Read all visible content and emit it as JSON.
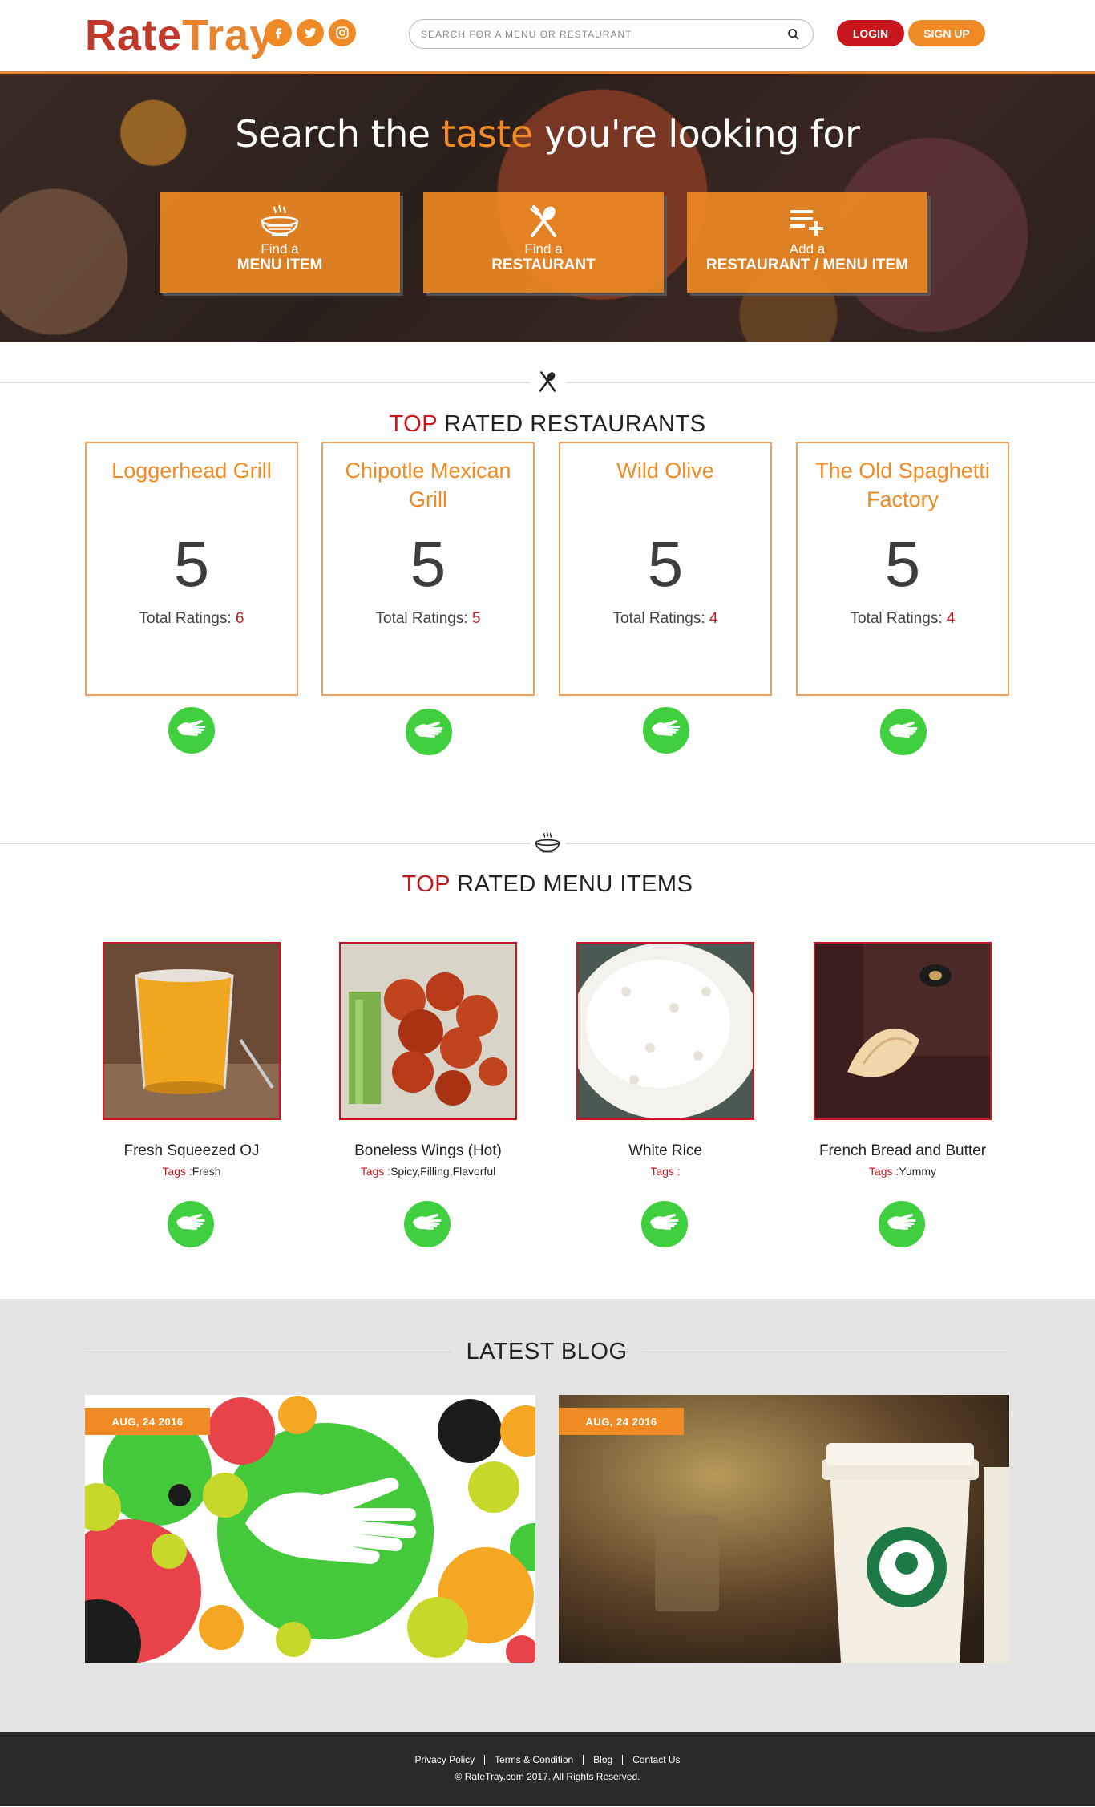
{
  "header": {
    "logo_part1": "Rate",
    "logo_part2": "Tray",
    "socials": [
      "facebook-icon",
      "twitter-icon",
      "instagram-icon"
    ],
    "search_placeholder": "SEARCH FOR A MENU OR RESTAURANT",
    "login_label": "LOGIN",
    "signup_label": "SIGN UP"
  },
  "hero": {
    "title_part1": "Search the ",
    "title_accent": "taste",
    "title_part2": " you're looking for",
    "buttons": [
      {
        "small": "Find a",
        "big": "MENU ITEM",
        "icon": "bowl-icon"
      },
      {
        "small": "Find a",
        "big": "RESTAURANT",
        "icon": "utensils-icon"
      },
      {
        "small": "Add a",
        "big": "RESTAURANT / MENU ITEM",
        "icon": "add-list-icon"
      }
    ]
  },
  "restaurants": {
    "title_top": "TOP",
    "title_rest": " RATED RESTAURANTS",
    "total_label": "Total Ratings: ",
    "items": [
      {
        "name": "Loggerhead Grill",
        "score": "5",
        "total": "6"
      },
      {
        "name": "Chipotle Mexican Grill",
        "score": "5",
        "total": "5"
      },
      {
        "name": "Wild Olive",
        "score": "5",
        "total": "4"
      },
      {
        "name": "The Old Spaghetti Factory",
        "score": "5",
        "total": "4"
      }
    ]
  },
  "menu_items": {
    "title_top": "TOP",
    "title_rest": " RATED MENU ITEMS",
    "tags_label": "Tags :",
    "items": [
      {
        "name": "Fresh Squeezed OJ",
        "tags": "Fresh"
      },
      {
        "name": "Boneless Wings (Hot)",
        "tags": "Spicy,Filling,Flavorful"
      },
      {
        "name": "White Rice",
        "tags": ""
      },
      {
        "name": "French Bread and Butter",
        "tags": "Yummy"
      }
    ]
  },
  "blog": {
    "title": "LATEST BLOG",
    "posts": [
      {
        "date": "AUG, 24 2016"
      },
      {
        "date": "AUG, 24 2016"
      }
    ]
  },
  "footer": {
    "links": [
      "Privacy Policy",
      "Terms & Condition",
      "Blog",
      "Contact Us"
    ],
    "copyright": "© RateTray.com 2017. All Rights Reserved."
  },
  "colors": {
    "brand_red": "#c8161d",
    "brand_orange": "#f08a24",
    "thumb_green": "#3fcf3f"
  }
}
